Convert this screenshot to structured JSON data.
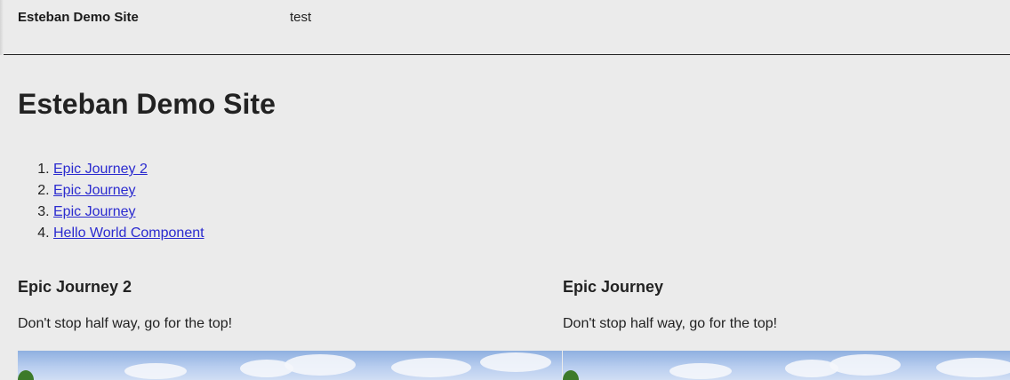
{
  "header": {
    "brand": "Esteban Demo Site",
    "nav_item": "test"
  },
  "main": {
    "title": "Esteban Demo Site",
    "toc": [
      {
        "label": "Epic Journey 2"
      },
      {
        "label": "Epic Journey"
      },
      {
        "label": "Epic Journey"
      },
      {
        "label": "Hello World Component"
      }
    ]
  },
  "cards": [
    {
      "title": "Epic Journey 2",
      "text": "Don't stop half way, go for the top!",
      "image": "sky-landscape-image"
    },
    {
      "title": "Epic Journey",
      "text": "Don't stop half way, go for the top!",
      "image": "sky-landscape-image"
    }
  ],
  "colors": {
    "background": "#ebebeb",
    "link": "#2a2acf",
    "text": "#222222"
  }
}
